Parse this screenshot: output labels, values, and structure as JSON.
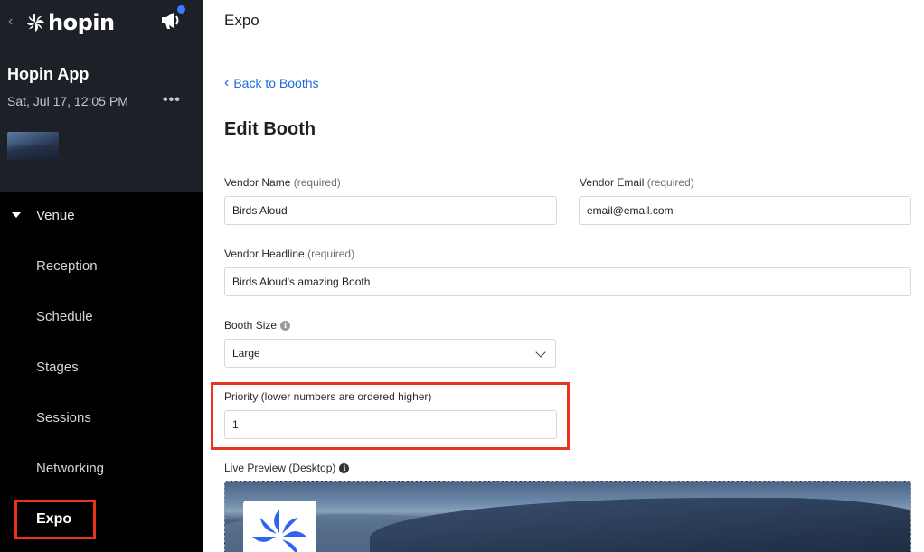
{
  "sidebar": {
    "brand": "hopin",
    "event_title": "Hopin App",
    "event_date": "Sat, Jul 17, 12:05 PM",
    "more_label": "•••",
    "venue_label": "Venue",
    "items": [
      {
        "label": "Reception"
      },
      {
        "label": "Schedule"
      },
      {
        "label": "Stages"
      },
      {
        "label": "Sessions"
      },
      {
        "label": "Networking"
      },
      {
        "label": "Expo"
      }
    ],
    "active_item": "Expo"
  },
  "header": {
    "title": "Expo"
  },
  "main": {
    "back_link": "Back to Booths",
    "page_title": "Edit Booth",
    "required_text": "(required)",
    "fields": {
      "vendor_name": {
        "label": "Vendor Name",
        "value": "Birds Aloud"
      },
      "vendor_email": {
        "label": "Vendor Email",
        "value": "email@email.com"
      },
      "vendor_headline": {
        "label": "Vendor Headline",
        "value": "Birds Aloud's amazing Booth"
      },
      "booth_size": {
        "label": "Booth Size",
        "value": "Large"
      },
      "priority": {
        "label": "Priority (lower numbers are ordered higher)",
        "value": "1"
      }
    },
    "live_preview_label": "Live Preview (Desktop)"
  },
  "colors": {
    "accent_link": "#1c6ae4",
    "highlight": "#e8341c",
    "sidebar_top": "#1d2127",
    "sidebar_bottom": "#000000",
    "notification": "#3b7bff"
  },
  "icons": [
    "chevron-left-icon",
    "hopin-logo-icon",
    "megaphone-icon",
    "more-icon",
    "caret-down-icon",
    "chevron-down-icon",
    "info-icon"
  ]
}
